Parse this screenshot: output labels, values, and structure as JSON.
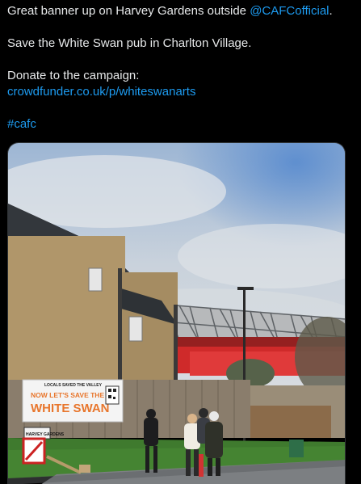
{
  "tweet": {
    "line1_prefix": "Great banner up on Harvey Gardens outside ",
    "mention": "@CAFCofficial",
    "line1_suffix": ".",
    "line2": "Save the White Swan pub in Charlton Village.",
    "line3": "Donate to the campaign:",
    "link": "crowdfunder.co.uk/p/whiteswanarts",
    "hashtag": "#cafc"
  },
  "photo": {
    "banner_small": "LOCALS SAVED THE VALLEY",
    "banner_line1": "NOW LET'S SAVE THE",
    "banner_line2": "WHITE SWAN",
    "street_sign": "HARVEY GARDENS"
  },
  "colors": {
    "link": "#1d9bf0",
    "banner_orange": "#e8762c",
    "stadium_red": "#d62b2b"
  }
}
